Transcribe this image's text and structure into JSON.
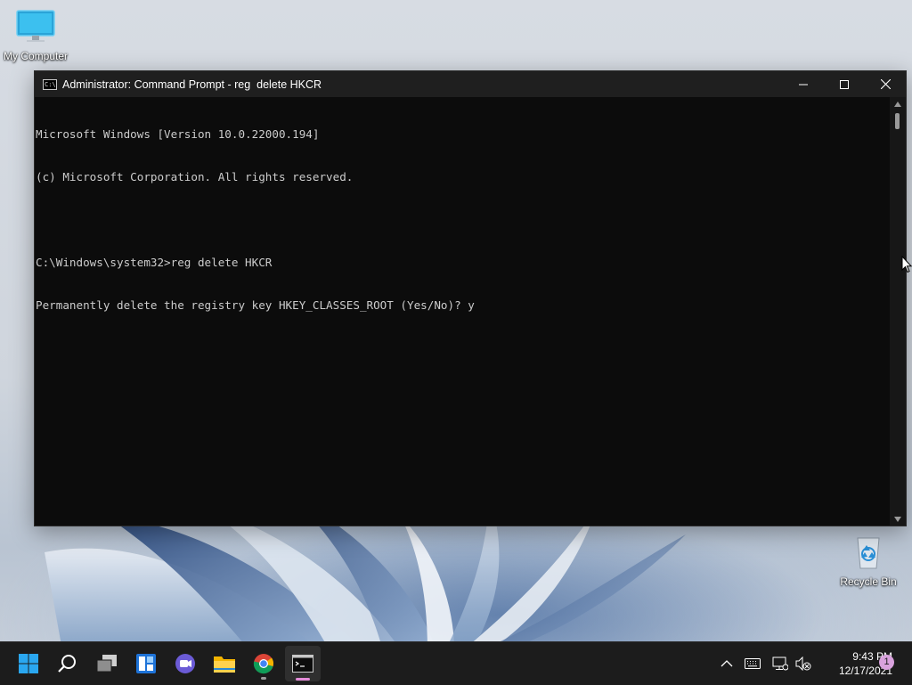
{
  "desktop": {
    "icons": [
      {
        "label": "My Computer"
      },
      {
        "label": "Recycle Bin"
      }
    ]
  },
  "window": {
    "title": "Administrator: Command Prompt - reg  delete HKCR",
    "controls": {
      "minimize": "minimize-icon",
      "maximize": "maximize-icon",
      "close": "close-icon"
    },
    "console_lines": [
      "Microsoft Windows [Version 10.0.22000.194]",
      "(c) Microsoft Corporation. All rights reserved.",
      "",
      "C:\\Windows\\system32>reg delete HKCR",
      "Permanently delete the registry key HKEY_CLASSES_ROOT (Yes/No)? y"
    ],
    "colors": {
      "console_bg": "#0c0c0c",
      "console_text": "#cccccc",
      "titlebar_bg": "#1f1f1f"
    }
  },
  "taskbar": {
    "apps": [
      {
        "icon": "windows-start-icon"
      },
      {
        "icon": "search-icon"
      },
      {
        "icon": "task-view-icon"
      },
      {
        "icon": "widgets-icon"
      },
      {
        "icon": "teams-chat-icon"
      },
      {
        "icon": "file-explorer-icon"
      },
      {
        "icon": "chrome-icon"
      },
      {
        "icon": "command-prompt-icon",
        "active": true
      }
    ],
    "tray": {
      "icons": [
        "chevron-up-icon",
        "keyboard-icon",
        "network-icon",
        "volume-muted-icon"
      ],
      "time": "9:43 PM",
      "date": "12/17/2021",
      "notification_count": "1"
    }
  }
}
